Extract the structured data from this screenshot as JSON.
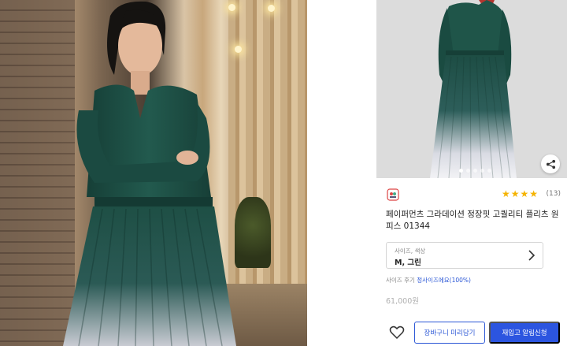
{
  "photo": {
    "description_icon": "scene-photo"
  },
  "product": {
    "image_dots": 5,
    "active_dot": 0,
    "rating_stars": "★★★★",
    "rating_value": 4,
    "review_count": "(13)",
    "title": "페이퍼먼츠 그라데이션 정장핏 고퀄리티 플리츠 원피스 01344",
    "option": {
      "label": "사이즈, 색상",
      "value": "M, 그린"
    },
    "size_review_label": "사이즈 후기",
    "size_review_value": "정사이즈에요(100%)",
    "price": "61,000원"
  },
  "actions": {
    "cart_label": "장바구니 미리담기",
    "restock_label": "재입고 알림신청"
  },
  "colors": {
    "accent": "#2c55e0",
    "star": "#f5b301",
    "dress": "#1e4f45"
  },
  "icons": [
    "share-icon",
    "chevron-right-icon",
    "heart-icon",
    "brand-logo-icon"
  ]
}
